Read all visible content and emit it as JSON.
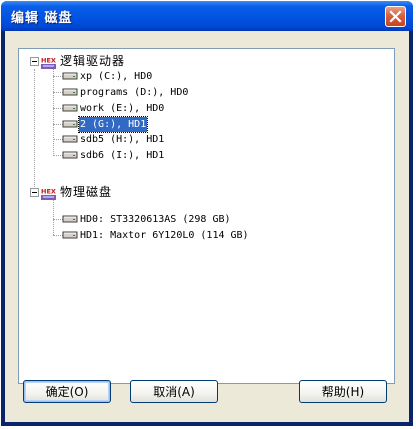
{
  "window": {
    "title": "编辑 磁盘"
  },
  "tree": {
    "groups": [
      {
        "label": "逻辑驱动器",
        "items": [
          {
            "label": "xp (C:), HD0",
            "selected": false
          },
          {
            "label": "programs (D:), HD0",
            "selected": false
          },
          {
            "label": "work (E:), HD0",
            "selected": false
          },
          {
            "label": "2 (G:), HD1",
            "selected": true
          },
          {
            "label": "sdb5 (H:), HD1",
            "selected": false
          },
          {
            "label": "sdb6 (I:), HD1",
            "selected": false
          }
        ]
      },
      {
        "label": "物理磁盘",
        "items": [
          {
            "label": "HD0: ST3320613AS (298 GB)",
            "selected": false
          },
          {
            "label": "HD1: Maxtor 6Y120L0 (114 GB)",
            "selected": false
          }
        ]
      }
    ],
    "icon_text": "HEX"
  },
  "buttons": {
    "ok": "确定(O)",
    "cancel": "取消(A)",
    "help": "帮助(H)"
  },
  "colors": {
    "selection": "#316ac5",
    "titlebar": "#0054e3",
    "close": "#d9603c"
  }
}
